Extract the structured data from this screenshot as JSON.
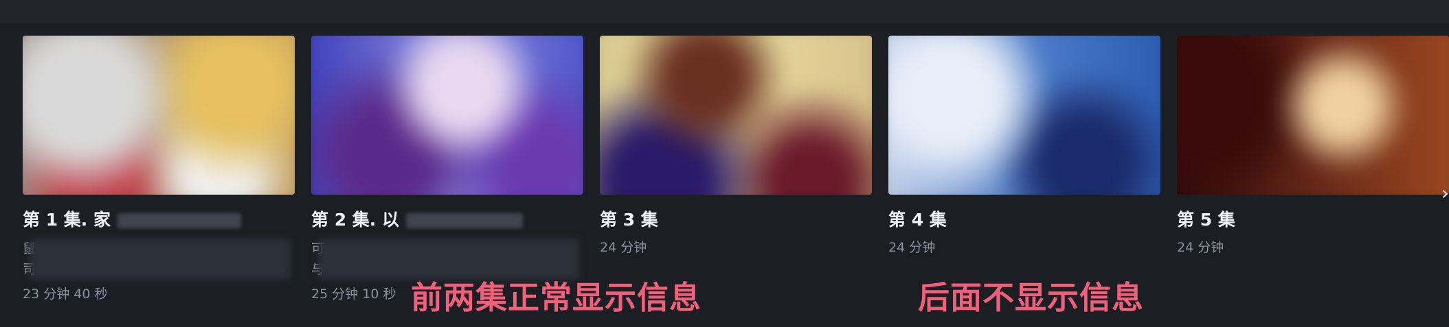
{
  "episodes": [
    {
      "title": "第 1 集. 家",
      "desc_fragments": [
        "鼠",
        "司"
      ],
      "duration": "23 分钟 40 秒"
    },
    {
      "title": "第 2 集. 以",
      "desc_fragments": [
        "可",
        "与"
      ],
      "duration": "25 分钟 10 秒"
    },
    {
      "title": "第 3 集",
      "duration": "24 分钟"
    },
    {
      "title": "第 4 集",
      "duration": "24 分钟"
    },
    {
      "title": "第 5 集",
      "duration": "24 分钟"
    }
  ],
  "annotations": {
    "left": "前两集正常显示信息",
    "right": "后面不显示信息",
    "color": "#f0607a"
  },
  "scroll_arrow": "›"
}
